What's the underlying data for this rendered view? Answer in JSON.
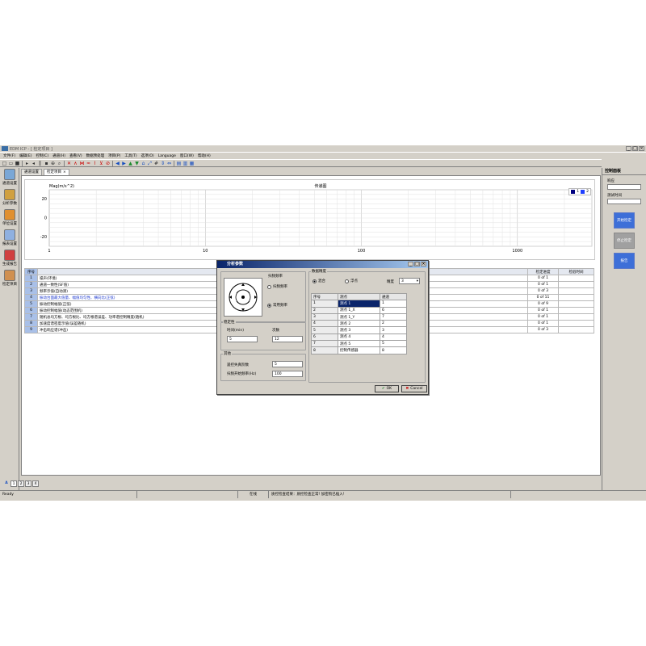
{
  "window": {
    "title": "EDM ICP - [ 检定项目 ]"
  },
  "menu": [
    "文件(F)",
    "编辑(E)",
    "控制(C)",
    "通道(H)",
    "查看(V)",
    "数据预处理",
    "项目(P)",
    "工具(T)",
    "选项(O)",
    "Language",
    "窗口(W)",
    "帮助(H)"
  ],
  "tabs": [
    "通道设置",
    "检定项目"
  ],
  "leftbar": [
    "通道设置",
    "分析参数",
    "单位设置",
    "报表设置",
    "生成报告",
    "检定项目"
  ],
  "chart_data": {
    "type": "line",
    "title": "传递图",
    "ylabel": "Mag(m/s^2)",
    "xlabel": "",
    "x_scale": "log",
    "xlim": [
      1,
      3000
    ],
    "ylim": [
      -30,
      30
    ],
    "xticks": [
      1,
      10,
      100,
      1000
    ],
    "yticks": [
      20,
      0,
      -20
    ],
    "xtick_labels": [
      "1",
      "10",
      "100",
      "1000"
    ],
    "ytick_labels": [
      "20",
      "0",
      "-20"
    ],
    "grid": true,
    "legend": [
      "1",
      "2"
    ],
    "legend_colors": [
      "#000080",
      "#2040ff"
    ],
    "series": []
  },
  "table": {
    "headers": [
      "序号",
      "",
      "检定进度",
      "检验时间"
    ],
    "rows": [
      {
        "no": "1",
        "name": "噪声(环境)",
        "count": "0 of 1"
      },
      {
        "no": "2",
        "name": "通道一致性(SF值)",
        "count": "0 of 1"
      },
      {
        "no": "3",
        "name": "频率示值(自动测)",
        "count": "0 of 3"
      },
      {
        "no": "4",
        "name": "振动台面最大值量、幅值均匀性、横向比(正弦)",
        "count": "0 of 11"
      },
      {
        "no": "5",
        "name": "振动控制幅值(正弦)",
        "count": "0 of 9"
      },
      {
        "no": "6",
        "name": "振动控制幅值(动态范围机)",
        "count": "0 of 1"
      },
      {
        "no": "7",
        "name": "随机总均方根、均方根比、均方根谱误差、功率谱控制精度(随机)",
        "count": "0 of 1"
      },
      {
        "no": "8",
        "name": "加速度谱密度示值(误差随机)",
        "count": "0 of 1"
      },
      {
        "no": "9",
        "name": "冲击响应谱(冲击)",
        "count": "0 of 3"
      }
    ]
  },
  "right_panel": {
    "title": "控制面板",
    "label1": "响应",
    "label2": "测试时间",
    "btn_start": "开始检定",
    "btn_stop": "停止检定",
    "btn_report": "报告"
  },
  "pages": [
    "1",
    "2",
    "3",
    "4"
  ],
  "status": {
    "ready": "Ready",
    "online": "在线",
    "message": "质控检查结果：质控检查正常! 加密狗已插入!"
  },
  "dialog": {
    "title": "分析参数",
    "grp_freq": "扫频频率",
    "radio_freq1": "扫频频率",
    "radio_freq2": "常用频率",
    "grp_stab": "稳定性",
    "time_label": "时间(min)",
    "time_value": "5",
    "count_label": "次数",
    "count_value": "12",
    "grp_other": "其他",
    "avg_label": "遥控失真阶数",
    "avg_value": "5",
    "sweep_label": "扫频开始频率(Hz)",
    "sweep_value": "100",
    "grp_precision": "数据精度",
    "radio_p1": "混合",
    "radio_p2": "浮点",
    "precision_label": "精度",
    "precision_value": "3",
    "table_headers": [
      "序号",
      "测点",
      "通道"
    ],
    "table_rows": [
      [
        "1",
        "测点 1",
        "1"
      ],
      [
        "2",
        "测点 1_X",
        "6"
      ],
      [
        "3",
        "测点 1_Y",
        "7"
      ],
      [
        "4",
        "测点 2",
        "2"
      ],
      [
        "5",
        "测点 3",
        "3"
      ],
      [
        "6",
        "测点 4",
        "4"
      ],
      [
        "7",
        "测点 5",
        "5"
      ],
      [
        "8",
        "控制传感器",
        "8"
      ]
    ],
    "ok": "OK",
    "cancel": "Cancel"
  }
}
